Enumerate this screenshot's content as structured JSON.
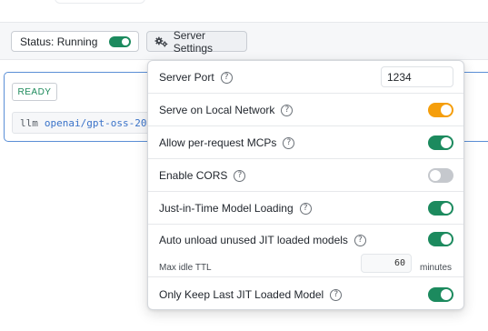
{
  "colors": {
    "toggle_on": "#1c8a5e",
    "toggle_orange": "#f59e0b",
    "toggle_off": "#c5c8cd",
    "ready_green": "#1d8a5b",
    "model_blue": "#3a73c9",
    "card_border": "#5b8fd6"
  },
  "toolbar": {
    "status_label": "Status: Running",
    "status_on": true,
    "settings_label": "Server Settings",
    "settings_icon": "gears-icon"
  },
  "card": {
    "badge": "READY",
    "cmd_prefix": "llm",
    "cmd_model": "openai/gpt-oss-20"
  },
  "settings": {
    "server_port": {
      "label": "Server Port",
      "value": "1234"
    },
    "serve_local": {
      "label": "Serve on Local Network",
      "on": true,
      "color": "orange"
    },
    "per_request_mcps": {
      "label": "Allow per-request MCPs",
      "on": true
    },
    "enable_cors": {
      "label": "Enable CORS",
      "on": false
    },
    "jit_loading": {
      "label": "Just-in-Time Model Loading",
      "on": true
    },
    "auto_unload": {
      "label": "Auto unload unused JIT loaded models",
      "on": true,
      "ttl_label": "Max idle TTL",
      "ttl_value": "60",
      "ttl_unit": "minutes"
    },
    "keep_last": {
      "label": "Only Keep Last JIT Loaded Model",
      "on": true
    }
  },
  "help_glyph": "?"
}
